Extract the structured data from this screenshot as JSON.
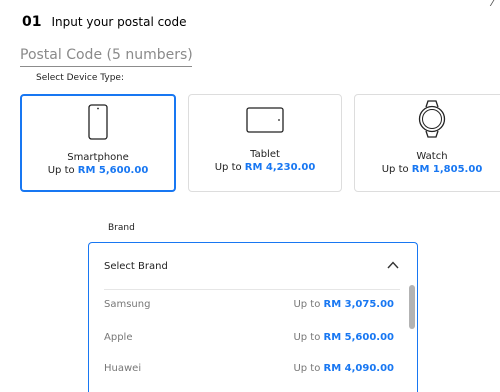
{
  "step": {
    "number": "01",
    "title": "Input your postal code"
  },
  "corner_mark": "⁄",
  "postal": {
    "placeholder": "Postal Code (5 numbers)",
    "value": ""
  },
  "device_label": "Select Device Type:",
  "devices": [
    {
      "name": "Smartphone",
      "prefix": "Up to",
      "price": "RM 5,600.00",
      "icon": "smartphone-icon",
      "selected": true
    },
    {
      "name": "Tablet",
      "prefix": "Up to",
      "price": "RM 4,230.00",
      "icon": "tablet-icon",
      "selected": false
    },
    {
      "name": "Watch",
      "prefix": "Up to",
      "price": "RM 1,805.00",
      "icon": "watch-icon",
      "selected": false
    }
  ],
  "brand": {
    "label": "Brand",
    "dropdown_title": "Select Brand",
    "expanded": true,
    "options": [
      {
        "name": "Samsung",
        "prefix": "Up to",
        "price": "RM 3,075.00"
      },
      {
        "name": "Apple",
        "prefix": "Up to",
        "price": "RM 5,600.00"
      },
      {
        "name": "Huawei",
        "prefix": "Up to",
        "price": "RM 4,090.00"
      }
    ]
  },
  "colors": {
    "accent": "#1877f2",
    "border": "#dddddd",
    "text": "#222222",
    "muted": "#777777"
  }
}
